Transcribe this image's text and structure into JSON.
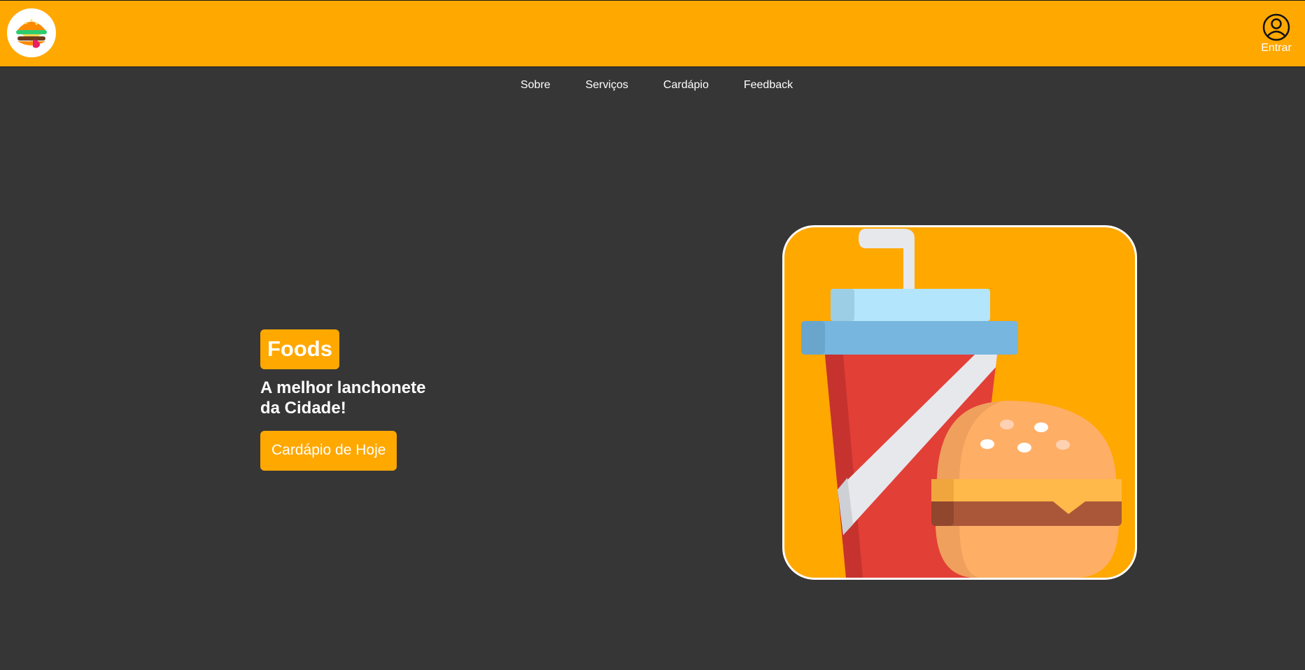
{
  "header": {
    "logo_icon": "burger-logo-icon",
    "login_icon": "user-circle-icon",
    "login_label": "Entrar",
    "brand_color": "#FFA800"
  },
  "nav": {
    "items": [
      {
        "label": "Sobre"
      },
      {
        "label": "Serviços"
      },
      {
        "label": "Cardápio"
      },
      {
        "label": "Feedback"
      }
    ]
  },
  "hero": {
    "brand": "Foods",
    "tagline": "A melhor lanchonete da Cidade!",
    "cta_label": "Cardápio de Hoje",
    "image_icon": "soda-and-burger-illustration",
    "background_color": "#363636"
  }
}
